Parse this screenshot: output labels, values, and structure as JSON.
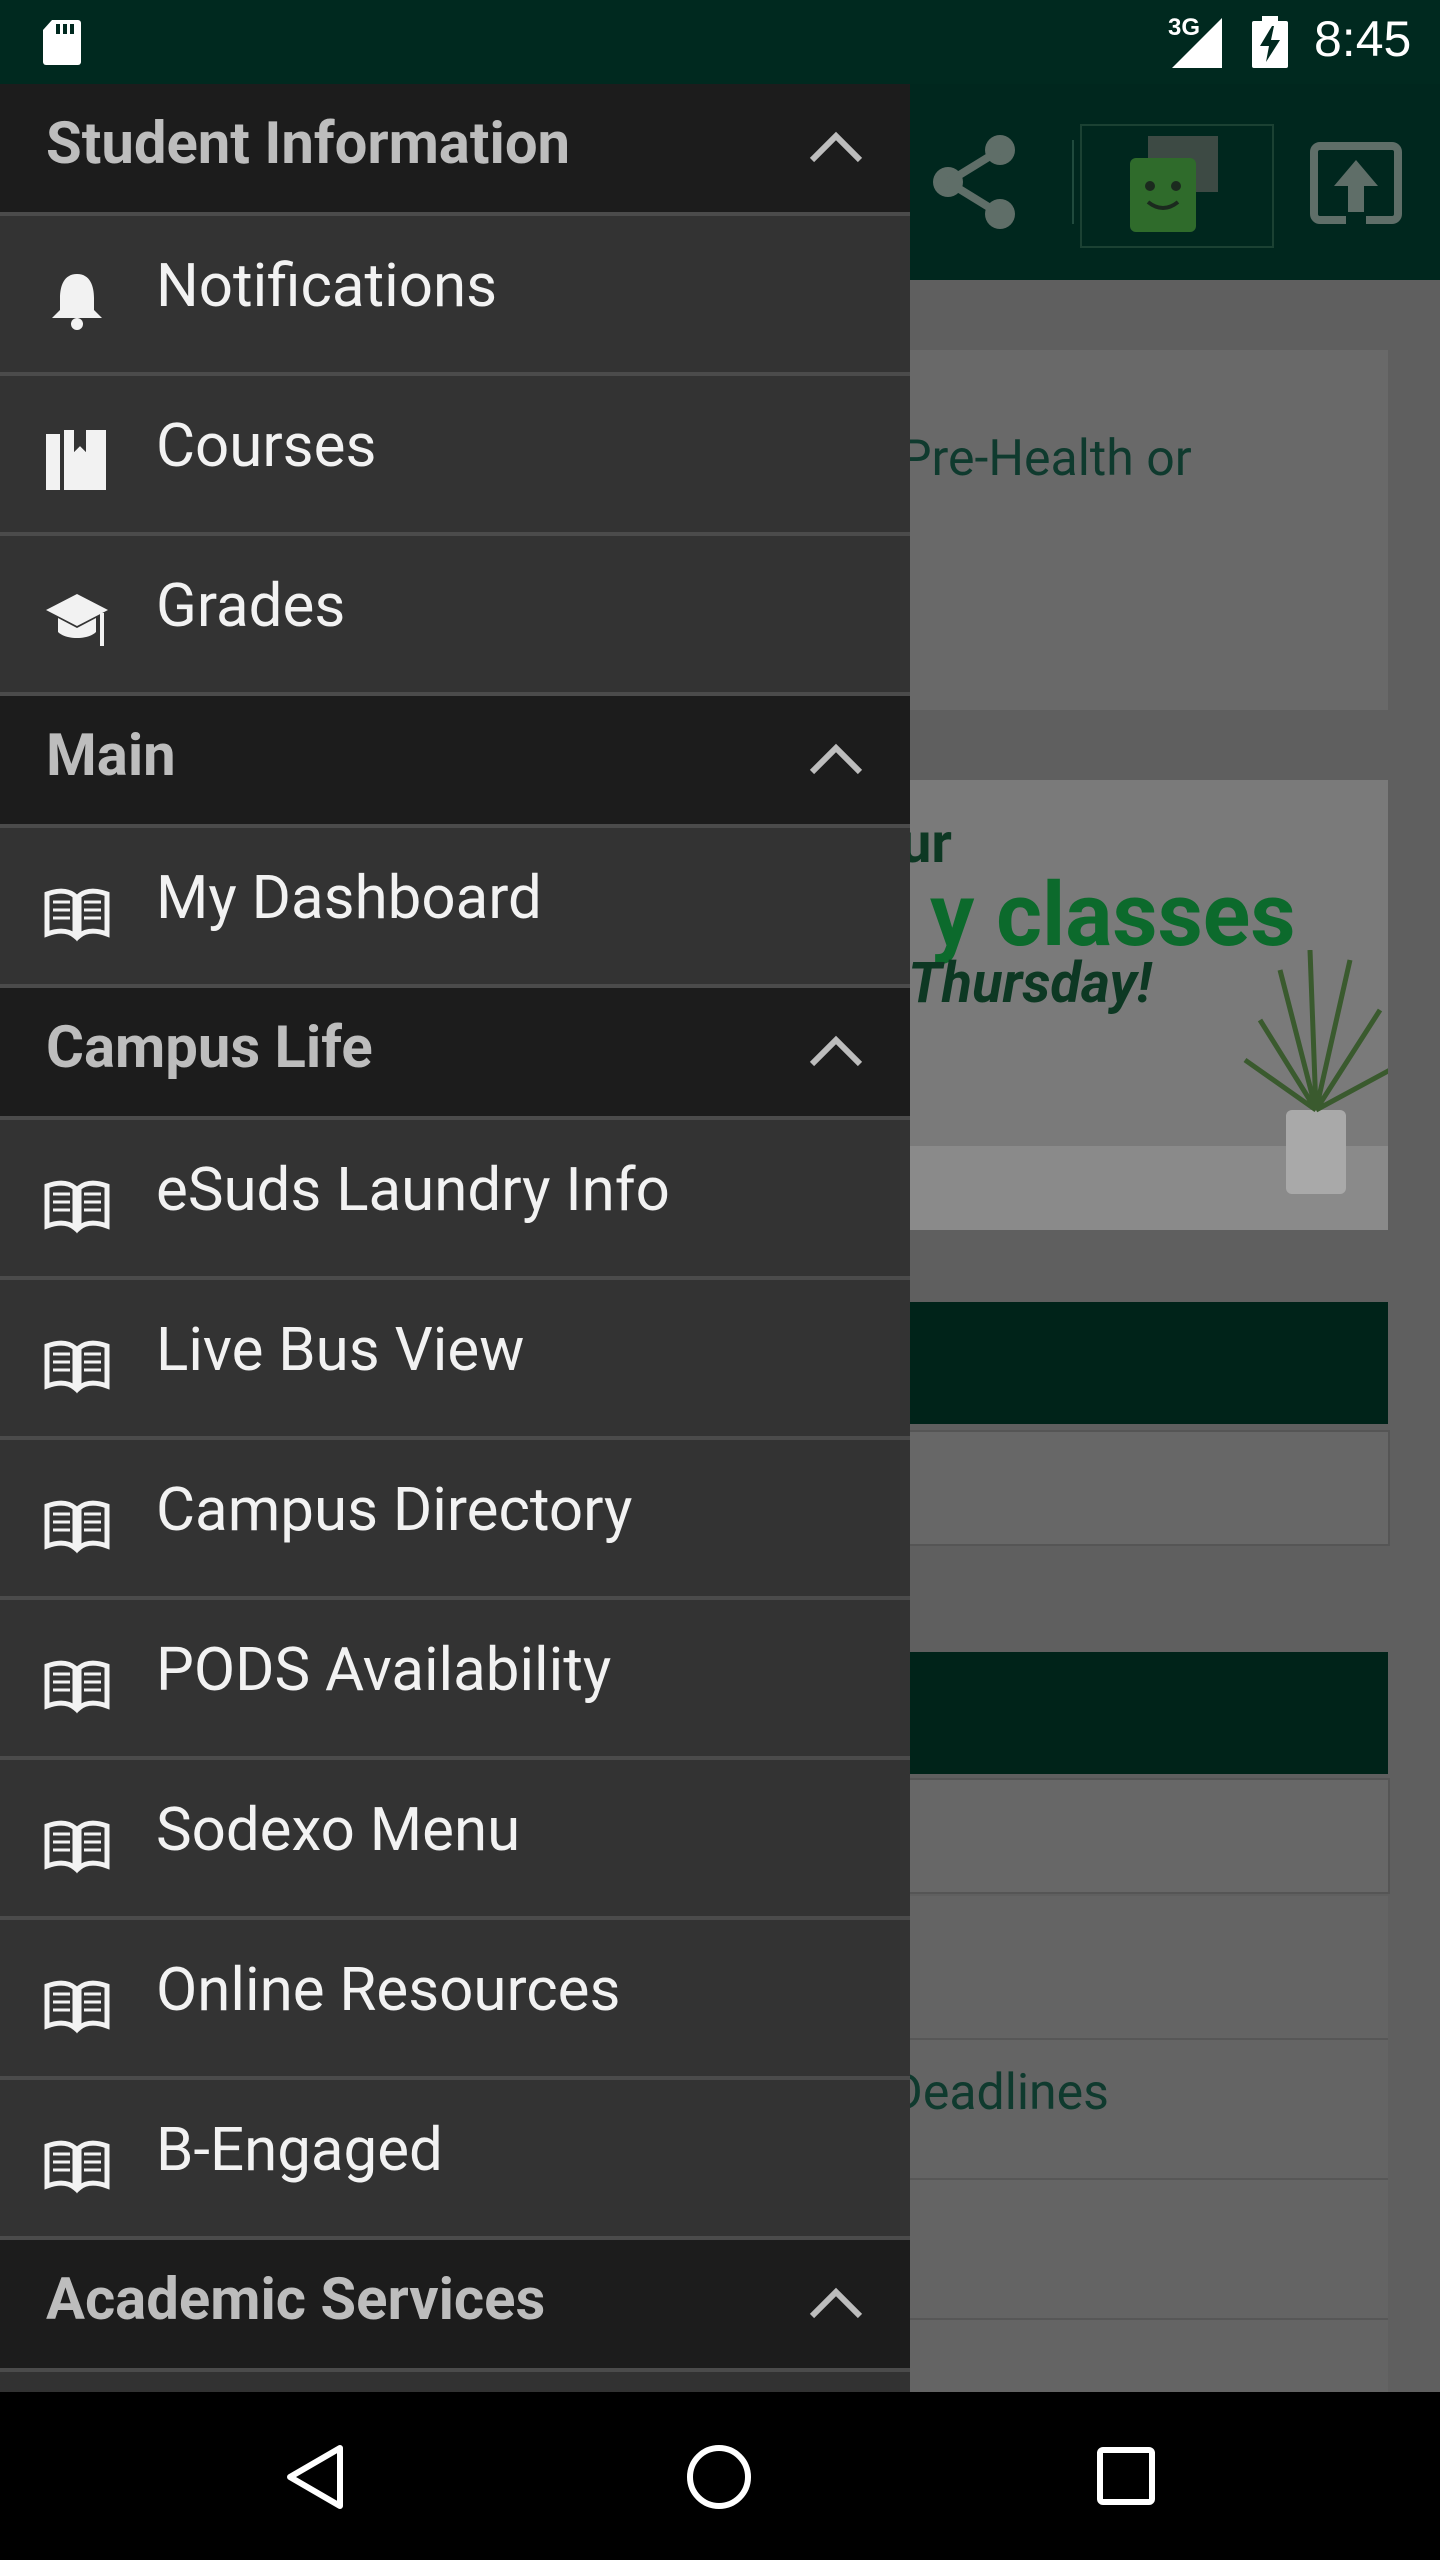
{
  "status_bar": {
    "network": "3G",
    "time": "8:45",
    "icons": [
      "sd-card-icon",
      "signal-icon",
      "battery-charging-icon"
    ]
  },
  "background_app": {
    "toolbar_icons": [
      "share-icon",
      "chat-bot-icon",
      "upload-icon"
    ],
    "card_text": "Pre-Health or",
    "banner": {
      "line1": "ur",
      "line2": "y classes",
      "line3": "Thursday!"
    },
    "list_item_text": "Deadlines"
  },
  "drawer": {
    "sections": [
      {
        "title": "Student Information",
        "items": [
          {
            "label": "Notifications",
            "icon": "bell-icon"
          },
          {
            "label": "Courses",
            "icon": "books-icon"
          },
          {
            "label": "Grades",
            "icon": "graduation-cap-icon"
          }
        ]
      },
      {
        "title": "Main",
        "items": [
          {
            "label": "My Dashboard",
            "icon": "open-book-icon"
          }
        ]
      },
      {
        "title": "Campus Life",
        "items": [
          {
            "label": "eSuds Laundry Info",
            "icon": "open-book-icon"
          },
          {
            "label": "Live Bus View",
            "icon": "open-book-icon"
          },
          {
            "label": "Campus Directory",
            "icon": "open-book-icon"
          },
          {
            "label": "PODS Availability",
            "icon": "open-book-icon"
          },
          {
            "label": "Sodexo Menu",
            "icon": "open-book-icon"
          },
          {
            "label": "Online Resources",
            "icon": "open-book-icon"
          },
          {
            "label": "B-Engaged",
            "icon": "open-book-icon"
          }
        ]
      },
      {
        "title": "Academic Services",
        "items": []
      }
    ]
  },
  "nav_bar": {
    "buttons": [
      "back-icon",
      "home-icon",
      "recents-icon"
    ]
  },
  "colors": {
    "status_bar": "#00291f",
    "drawer_bg": "#333333",
    "section_header_bg": "#1c1c1c",
    "section_title": "#bdbdbd",
    "item_text": "#f2f2f2",
    "brand_green": "#0c6a2c"
  }
}
